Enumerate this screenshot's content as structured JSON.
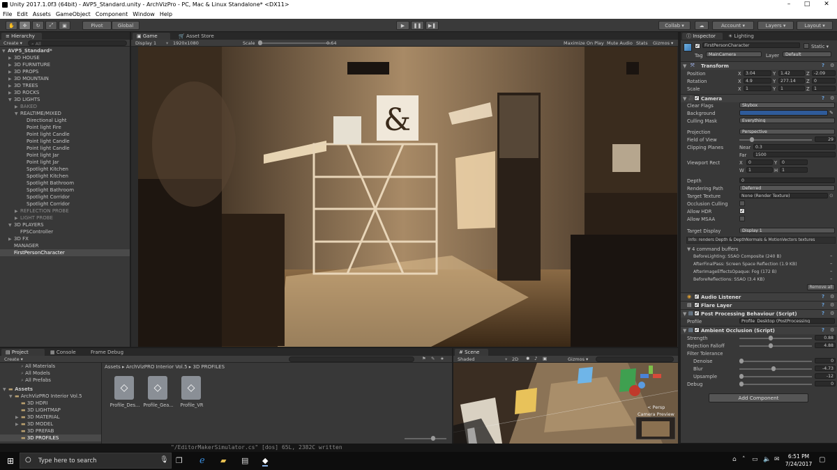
{
  "window": {
    "title": "Unity 2017.1.0f3 (64bit) - AVP5_Standard.unity - ArchVizPro - PC, Mac & Linux Standalone* <DX11>",
    "min": "–",
    "max": "□",
    "close": "✕"
  },
  "menu": [
    "File",
    "Edit",
    "Assets",
    "GameObject",
    "Component",
    "Window",
    "Help"
  ],
  "toolbar": {
    "pivot": "Pivot",
    "global": "Global",
    "collab": "Collab ▾",
    "account": "Account",
    "layers": "Layers",
    "layout": "Layout",
    "cloud": "☁"
  },
  "hierarchy": {
    "tab": "Hierarchy",
    "create": "Create ▾",
    "search_placeholder": "All",
    "items": [
      {
        "label": "AVP5_Standard*",
        "indent": 0,
        "tri": "▼",
        "state": "root"
      },
      {
        "label": "3D HOUSE",
        "indent": 1,
        "tri": "▶"
      },
      {
        "label": "3D FURNITURE",
        "indent": 1,
        "tri": "▶"
      },
      {
        "label": "3D PROPS",
        "indent": 1,
        "tri": "▶"
      },
      {
        "label": "3D MOUNTAIN",
        "indent": 1,
        "tri": "▶"
      },
      {
        "label": "3D TREES",
        "indent": 1,
        "tri": "▶"
      },
      {
        "label": "3D ROCKS",
        "indent": 1,
        "tri": "▶"
      },
      {
        "label": "3D LIGHTS",
        "indent": 1,
        "tri": "▼"
      },
      {
        "label": "BAKED",
        "indent": 2,
        "tri": "▶",
        "state": "dim"
      },
      {
        "label": "REALTIME/MIXED",
        "indent": 2,
        "tri": "▼"
      },
      {
        "label": "Directional Light",
        "indent": 3,
        "tri": ""
      },
      {
        "label": "Point light Fire",
        "indent": 3,
        "tri": ""
      },
      {
        "label": "Point light Candle",
        "indent": 3,
        "tri": ""
      },
      {
        "label": "Point light Candle",
        "indent": 3,
        "tri": ""
      },
      {
        "label": "Point light Candle",
        "indent": 3,
        "tri": ""
      },
      {
        "label": "Point light Jar",
        "indent": 3,
        "tri": ""
      },
      {
        "label": "Point light Jar",
        "indent": 3,
        "tri": ""
      },
      {
        "label": "Spotlight Kitchen",
        "indent": 3,
        "tri": ""
      },
      {
        "label": "Spotlight Kitchen",
        "indent": 3,
        "tri": ""
      },
      {
        "label": "Spotlight Bathroom",
        "indent": 3,
        "tri": ""
      },
      {
        "label": "Spotlight Bathroom",
        "indent": 3,
        "tri": ""
      },
      {
        "label": "Spotlight Corridor",
        "indent": 3,
        "tri": ""
      },
      {
        "label": "Spotlight Corridor",
        "indent": 3,
        "tri": ""
      },
      {
        "label": "REFLECTION PROBE",
        "indent": 2,
        "tri": "▶",
        "state": "dim"
      },
      {
        "label": "LIGHT PROBE",
        "indent": 2,
        "tri": "▶",
        "state": "dim"
      },
      {
        "label": "3D PLAYERS",
        "indent": 1,
        "tri": "▼"
      },
      {
        "label": "FPSController",
        "indent": 2,
        "tri": ""
      },
      {
        "label": "3D FX",
        "indent": 1,
        "tri": "▶"
      },
      {
        "label": "MANAGER",
        "indent": 1,
        "tri": ""
      },
      {
        "label": "FirstPersonCharacter",
        "indent": 1,
        "tri": "",
        "state": "sel"
      }
    ]
  },
  "game": {
    "tab_game": "Game",
    "tab_store": "Asset Store",
    "display": "Display 1",
    "resolution": "1920x1080",
    "scale_label": "Scale",
    "scale_value": "0.64",
    "maximize": "Maximize On Play",
    "mute": "Mute Audio",
    "stats": "Stats",
    "gizmos": "Gizmos ▾"
  },
  "inspector": {
    "tab_inspector": "Inspector",
    "tab_lighting": "Lighting",
    "object_name": "FirstPersonCharacter",
    "static": "Static ▾",
    "tag_label": "Tag",
    "tag_value": "MainCamera",
    "layer_label": "Layer",
    "layer_value": "Default",
    "transform": {
      "title": "Transform",
      "position_label": "Position",
      "px": "3.04",
      "py": "1.42",
      "pz": "-2.09",
      "rotation_label": "Rotation",
      "rx": "4.9",
      "ry": "277.14",
      "rz": "0",
      "scale_label": "Scale",
      "sx": "1",
      "sy": "1",
      "sz": "1"
    },
    "camera": {
      "title": "Camera",
      "clear_flags_label": "Clear Flags",
      "clear_flags": "Skybox",
      "background_label": "Background",
      "background_color": "#2f5b9a",
      "culling_label": "Culling Mask",
      "culling": "Everything",
      "projection_label": "Projection",
      "projection": "Perspective",
      "fov_label": "Field of View",
      "fov": "29",
      "clipping_label": "Clipping Planes",
      "near_label": "Near",
      "near": "0.3",
      "far_label": "Far",
      "far": "1500",
      "viewport_label": "Viewport Rect",
      "vx": "0",
      "vy": "0",
      "vw": "1",
      "vh": "1",
      "depth_label": "Depth",
      "depth": "0",
      "rendering_label": "Rendering Path",
      "rendering": "Deferred",
      "target_label": "Target Texture",
      "target": "None (Render Texture)",
      "occlusion_label": "Occlusion Culling",
      "hdr_label": "Allow HDR",
      "msaa_label": "Allow MSAA",
      "display_label": "Target Display",
      "display": "Display 1",
      "info": "Info: renders Depth & DepthNormals & MotionVectors textures",
      "buffers_title": "4 command buffers",
      "buffers": [
        "BeforeLighting: SSAO Composite (240 B)",
        "AfterFinalPass: Screen Space Reflection (1.9 KB)",
        "AfterImageEffectsOpaque: Fog (172 B)",
        "BeforeReflections: SSAO (3.4 KB)"
      ],
      "remove_all": "Remove all"
    },
    "audio_listener": "Audio Listener",
    "flare_layer": "Flare Layer",
    "post_processing": {
      "title": "Post Processing Behaviour (Script)",
      "profile_label": "Profile",
      "profile": "Profile_Desktop (PostProcessing"
    },
    "ambient": {
      "title": "Ambient Occlusion (Script)",
      "strength_label": "Strength",
      "strength": "0.88",
      "falloff_label": "Rejection Falloff",
      "falloff": "4.88",
      "filter_label": "Filter Tolerance",
      "denoise_label": "Denoise",
      "denoise": "0",
      "blur_label": "Blur",
      "blur": "-4.73",
      "upsample_label": "Upsample",
      "upsample": "-12",
      "debug_label": "Debug",
      "debug": "0"
    },
    "add_component": "Add Component"
  },
  "project": {
    "tab_project": "Project",
    "tab_console": "Console",
    "tab_frame": "Frame Debug",
    "create": "Create ▾",
    "favorites": [
      "All Materials",
      "All Models",
      "All Prefabs"
    ],
    "assets_root": "Assets",
    "tree": [
      {
        "label": "ArchVizPRO Interior Vol.5",
        "indent": 1,
        "tri": "▼"
      },
      {
        "label": "3D HDRI",
        "indent": 2,
        "tri": ""
      },
      {
        "label": "3D LIGHTMAP",
        "indent": 2,
        "tri": ""
      },
      {
        "label": "3D MATERIAL",
        "indent": 2,
        "tri": "▶"
      },
      {
        "label": "3D MODEL",
        "indent": 2,
        "tri": "▶"
      },
      {
        "label": "3D PREFAB",
        "indent": 2,
        "tri": ""
      },
      {
        "label": "3D PROFILES",
        "indent": 2,
        "tri": "",
        "state": "sel"
      }
    ],
    "breadcrumb": "Assets ▸ ArchVizPRO Interior Vol.5 ▸ 3D PROFILES",
    "files": [
      "Profile_Des...",
      "Profile_Gea...",
      "Profile_VR"
    ]
  },
  "scene": {
    "tab": "Scene",
    "shaded": "Shaded",
    "mode2d": "2D",
    "gizmos": "Gizmos ▾",
    "persp": "< Persp",
    "camera_preview": "Camera Preview"
  },
  "taskbar": {
    "search_placeholder": "Type here to search",
    "terminal_line": "\"/EditorMakerSimulator.cs\" [dos] 65L, 2382C written",
    "time": "6:51 PM",
    "date": "7/24/2017"
  }
}
